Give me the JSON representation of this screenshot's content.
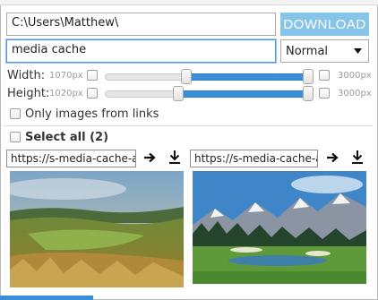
{
  "folder": {
    "value": "C:\\Users\\Matthew\\"
  },
  "search": {
    "value": "media cache"
  },
  "download_button": {
    "label": "DOWNLOAD"
  },
  "mode_select": {
    "selected": "Normal"
  },
  "width_filter": {
    "label": "Width:",
    "min_value": "1070px",
    "max_value": "3000px",
    "range_fraction": [
      0.38,
      1.0
    ]
  },
  "height_filter": {
    "label": "Height:",
    "min_value": "1020px",
    "max_value": "3000px",
    "range_fraction": [
      0.34,
      1.0
    ]
  },
  "links_only": {
    "label": "Only images from links"
  },
  "select_all": {
    "label": "Select all (2)"
  },
  "images": [
    {
      "url": "https://s-media-cache-ak",
      "subject": "golf course with tall grass"
    },
    {
      "url": "https://s-media-cache-ak",
      "subject": "golf course with mountains and lake"
    }
  ],
  "colors": {
    "accent": "#86c4ea",
    "slider_fill": "#3b8ed8",
    "focus": "#4d90fe"
  }
}
